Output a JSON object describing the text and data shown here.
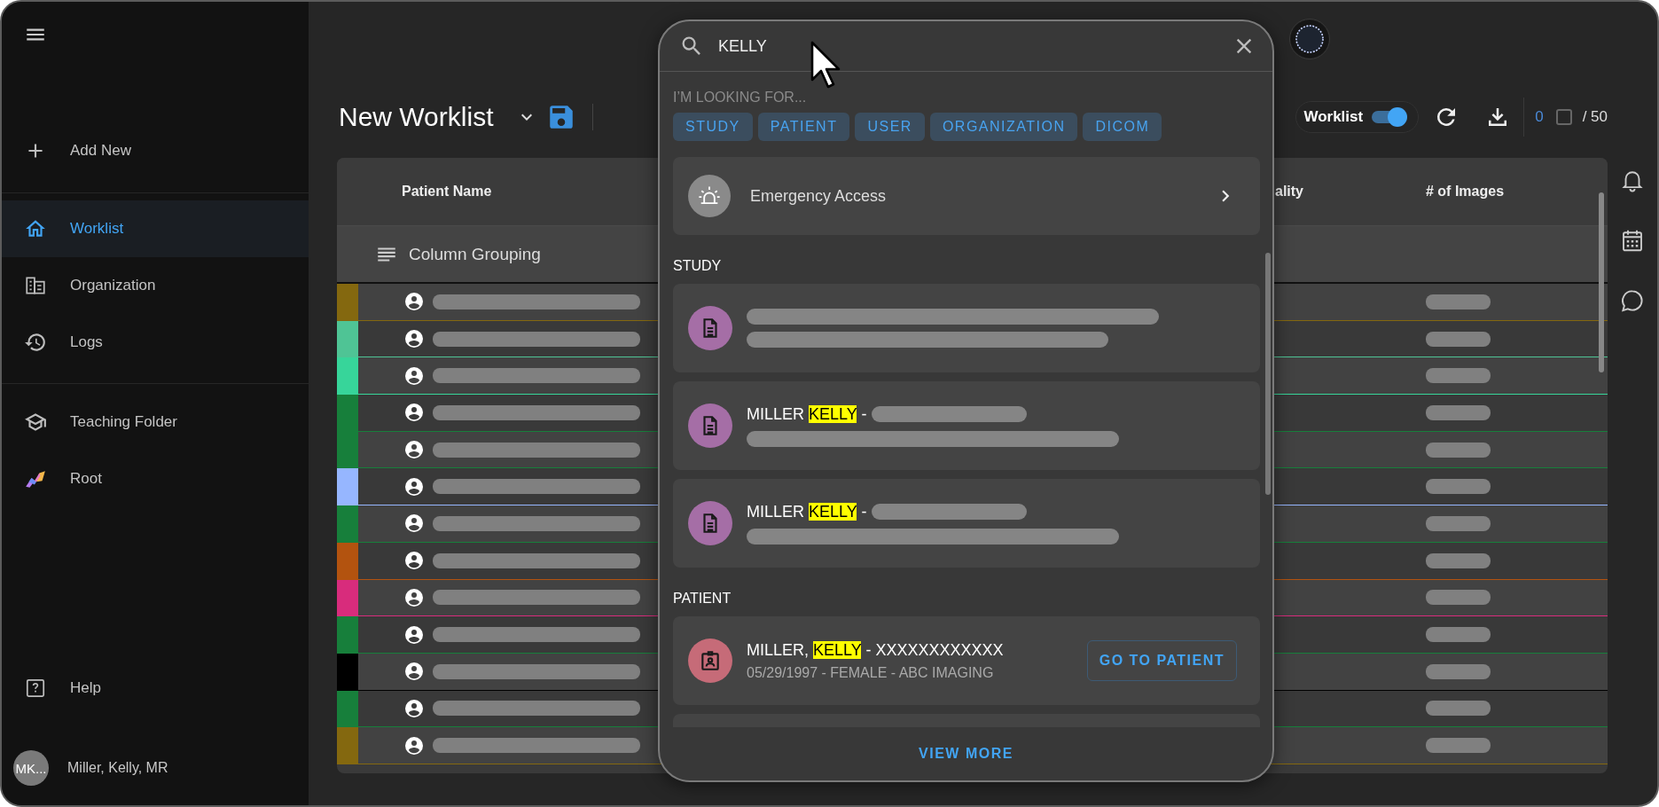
{
  "sidebar": {
    "sections": [
      {
        "items": [
          {
            "label": "Add New",
            "selected": false
          }
        ]
      },
      {
        "items": [
          {
            "label": "Worklist",
            "selected": true
          },
          {
            "label": "Organization",
            "selected": false
          },
          {
            "label": "Logs",
            "selected": false
          }
        ]
      },
      {
        "items": [
          {
            "label": "Teaching Folder",
            "selected": false
          },
          {
            "label": "Root",
            "selected": false
          }
        ]
      }
    ],
    "help": "Help",
    "user": {
      "initials": "MK...",
      "name": "Miller, Kelly, MR"
    }
  },
  "toolbar": {
    "title": "New Worklist",
    "toggle": {
      "label": "Worklist",
      "on": true
    },
    "selected_count": "0",
    "select_all": {
      "checked": false
    },
    "total": "/ 50"
  },
  "table": {
    "columns": [
      "Patient Name",
      "ality",
      "# of Images"
    ],
    "grouping": "Column Grouping",
    "rows": [
      {
        "color": "#84680f"
      },
      {
        "color": "#4fc495"
      },
      {
        "color": "#37d59a"
      },
      {
        "color": "#177f3b"
      },
      {
        "color": "#177f3b"
      },
      {
        "color": "#96b6ff"
      },
      {
        "color": "#177f3b"
      },
      {
        "color": "#b3530f"
      },
      {
        "color": "#d82c7c"
      },
      {
        "color": "#177f3b"
      },
      {
        "color": "#000000"
      },
      {
        "color": "#177f3b"
      },
      {
        "color": "#84680f"
      }
    ]
  },
  "search": {
    "value": "KELLY",
    "hint": "I’M LOOKING FOR...",
    "chips": [
      "STUDY",
      "PATIENT",
      "USER",
      "ORGANIZATION",
      "DICOM"
    ],
    "emergency": "Emergency Access",
    "sections": [
      {
        "title": "STUDY",
        "results": [
          {
            "kind": "study"
          },
          {
            "kind": "study",
            "name": "MILLER",
            "match": "KELLY",
            "rest": "-"
          },
          {
            "kind": "study",
            "name": "MILLER",
            "match": "KELLY",
            "rest": "-"
          }
        ]
      },
      {
        "title": "PATIENT",
        "results": [
          {
            "kind": "patient",
            "name": "MILLER,",
            "match": "KELLY",
            "rest": "- XXXXXXXXXXXX",
            "details": "05/29/1997 - FEMALE - ABC IMAGING",
            "action": "GO TO PATIENT"
          },
          {
            "kind": "patient"
          }
        ]
      }
    ],
    "footer": "VIEW MORE"
  }
}
